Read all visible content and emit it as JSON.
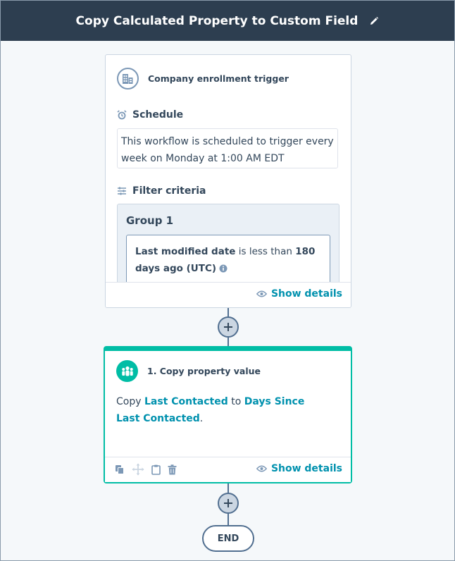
{
  "header": {
    "title": "Copy Calculated Property to Custom Field",
    "edit_icon": "pencil-icon"
  },
  "trigger": {
    "title": "Company enrollment trigger",
    "icon": "building-icon",
    "schedule_label": "Schedule",
    "schedule_text": "This workflow is scheduled to trigger every week on Monday at 1:00 AM EDT",
    "filter_label": "Filter criteria",
    "group_title": "Group 1",
    "filter": {
      "property": "Last modified date",
      "operator": "is less than",
      "value": "180 days ago (UTC)"
    },
    "show_details": "Show details"
  },
  "action": {
    "title": "1. Copy property value",
    "icon": "people-icon",
    "text_prefix": "Copy",
    "source": "Last Contacted",
    "text_mid": "to",
    "target": "Days Since Last Contacted",
    "text_suffix": ".",
    "show_details": "Show details",
    "tools": [
      "copy-icon",
      "move-icon",
      "clipboard-icon",
      "trash-icon"
    ]
  },
  "end_label": "END",
  "colors": {
    "header_bg": "#2d3e50",
    "accent": "#00bda5",
    "link": "#0091ae",
    "text": "#33475b"
  }
}
